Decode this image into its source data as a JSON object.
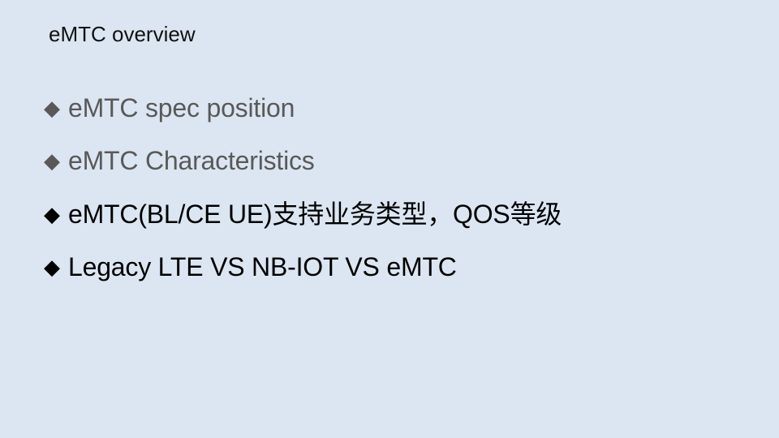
{
  "slide": {
    "title": "eMTC overview",
    "bullet_marker": "◆",
    "items": [
      {
        "text": "eMTC spec position",
        "color": "#595959"
      },
      {
        "text": "eMTC Characteristics",
        "color": "#595959"
      },
      {
        "text": "eMTC(BL/CE UE)支持业务类型，QOS等级",
        "color": "#000000"
      },
      {
        "text": "Legacy LTE VS NB-IOT VS eMTC",
        "color": "#000000"
      }
    ],
    "background_color": "#dce6f2"
  }
}
